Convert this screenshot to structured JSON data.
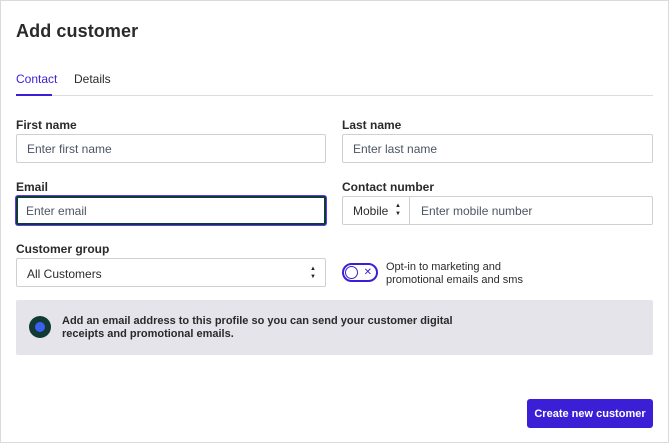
{
  "page": {
    "title": "Add customer"
  },
  "tabs": [
    {
      "label": "Contact",
      "active": true
    },
    {
      "label": "Details",
      "active": false
    }
  ],
  "form": {
    "first_name": {
      "label": "First name",
      "placeholder": "Enter first name",
      "value": ""
    },
    "last_name": {
      "label": "Last name",
      "placeholder": "Enter last name",
      "value": ""
    },
    "email": {
      "label": "Email",
      "placeholder": "Enter email",
      "value": "",
      "focused": true
    },
    "contact_number": {
      "label": "Contact number",
      "type_selected": "Mobile",
      "placeholder": "Enter mobile number",
      "value": ""
    },
    "customer_group": {
      "label": "Customer group",
      "selected": "All Customers"
    },
    "opt_in": {
      "label": "Opt-in to marketing and promotional emails and sms",
      "enabled": false
    }
  },
  "notice": {
    "text": "Add an email address to this profile so you can send your customer digital receipts and promotional emails."
  },
  "actions": {
    "create_label": "Create new customer"
  },
  "colors": {
    "accent": "#3a1fd6",
    "focus_ring": "#123a34",
    "notice_bg": "#e4e4ea"
  }
}
